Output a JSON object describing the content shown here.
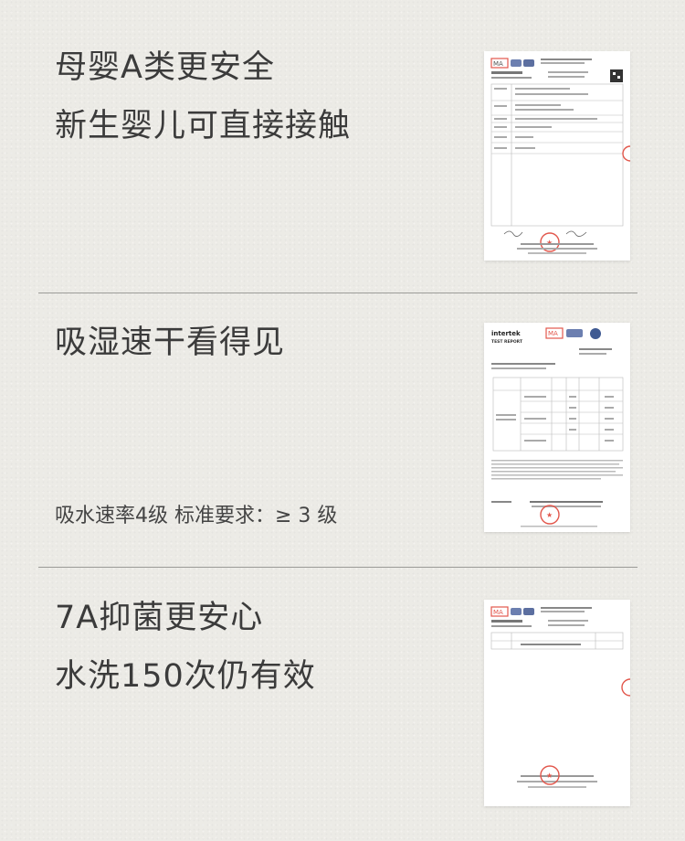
{
  "sections": [
    {
      "lines": [
        "母婴A类更安全",
        "新生婴儿可直接接触"
      ]
    },
    {
      "lines": [
        "吸湿速干看得见"
      ],
      "note": "吸水速率4级  标准要求：≥ 3 级",
      "report": {
        "brand": "intertek",
        "heading": "TEST REPORT"
      }
    },
    {
      "lines": [
        "7A抑菌更安心",
        "水洗150次仍有效"
      ]
    }
  ],
  "colors": {
    "stamp": "#e2574c",
    "text": "#3b3b3b",
    "divider": "#9a9a96"
  }
}
